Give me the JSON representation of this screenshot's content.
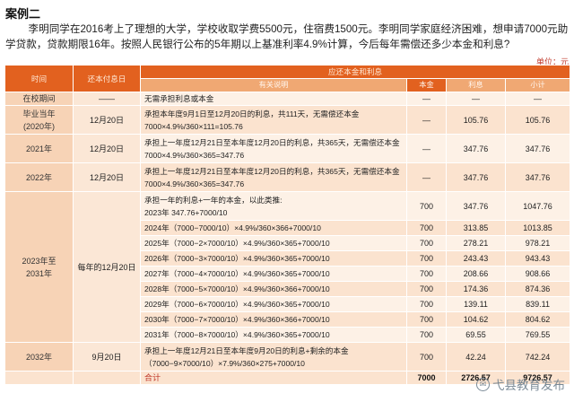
{
  "case_title": "案例二",
  "intro": "李明同学在2016考上了理想的大学，学校收取学费5500元，住宿费1500元。李明同学家庭经济困难，想申请7000元助学贷款，贷款期限16年。按照人民银行公布的5年期以上基准利率4.9%计算，今后每年需偿还多少本金和利息?",
  "unit": "单位：元",
  "headers": {
    "time": "时间",
    "pay_date": "还本付息日",
    "group": "应还本金和利息",
    "desc": "有关说明",
    "principal": "本金",
    "interest": "利息",
    "subtotal": "小计"
  },
  "rows": {
    "r0": {
      "time": "在校期间",
      "date": "——",
      "desc": "无需承担利息或本金",
      "principal": "—",
      "interest": "—",
      "subtotal": "—"
    },
    "r1": {
      "time": "毕业当年\n(2020年)",
      "date": "12月20日",
      "desc": "承担本年度9月1日至12月20日的利息，共111天，无需偿还本金\n7000×4.9%/360×111=105.76",
      "principal": "—",
      "interest": "105.76",
      "subtotal": "105.76"
    },
    "r2": {
      "time": "2021年",
      "date": "12月20日",
      "desc": "承担上一年度12月21日至本年度12月20日的利息，共365天，无需偿还本金\n7000×4.9%/360×365=347.76",
      "principal": "—",
      "interest": "347.76",
      "subtotal": "347.76"
    },
    "r3": {
      "time": "2022年",
      "date": "12月20日",
      "desc": "承担上一年度12月21日至本年度12月20日的利息，共365天，无需偿还本金\n7000×4.9%/360×365=347.76",
      "principal": "—",
      "interest": "347.76",
      "subtotal": "347.76"
    },
    "r4": {
      "desc": "承担一年的利息+一年的本金，以此类推:\n2023年 347.76+7000/10",
      "principal": "700",
      "interest": "347.76",
      "subtotal": "1047.76"
    },
    "r5": {
      "desc": "2024年（7000−7000/10）×4.9%/360×366+7000/10",
      "principal": "700",
      "interest": "313.85",
      "subtotal": "1013.85"
    },
    "r6": {
      "desc": "2025年（7000−2×7000/10）×4.9%/360×365+7000/10",
      "principal": "700",
      "interest": "278.21",
      "subtotal": "978.21"
    },
    "r7": {
      "desc": "2026年（7000−3×7000/10）×4.9%/360×365+7000/10",
      "principal": "700",
      "interest": "243.43",
      "subtotal": "943.43"
    },
    "r8": {
      "desc": "2027年（7000−4×7000/10）×4.9%/360×365+7000/10",
      "principal": "700",
      "interest": "208.66",
      "subtotal": "908.66"
    },
    "r9": {
      "desc": "2028年（7000−5×7000/10）×4.9%/360×366+7000/10",
      "principal": "700",
      "interest": "174.36",
      "subtotal": "874.36"
    },
    "r10": {
      "desc": "2029年（7000−6×7000/10）×4.9%/360×365+7000/10",
      "principal": "700",
      "interest": "139.11",
      "subtotal": "839.11"
    },
    "r11": {
      "desc": "2030年（7000−7×7000/10）×4.9%/360×366+7000/10",
      "principal": "700",
      "interest": "104.62",
      "subtotal": "804.62"
    },
    "r12": {
      "desc": "2031年（7000−8×7000/10）×4.9%/360×365+7000/10",
      "principal": "700",
      "interest": "69.55",
      "subtotal": "769.55"
    },
    "r13": {
      "time": "2032年",
      "date": "9月20日",
      "desc": "承担上一年度12月21日至本年度9月20日的利息+剩余的本金\n（7000−9×7000/10）×7.9%/360×275+7000/10",
      "principal": "700",
      "interest": "42.24",
      "subtotal": "742.24"
    }
  },
  "group_2023": {
    "time": "2023年至\n2031年",
    "date": "每年的12月20日"
  },
  "total": {
    "label": "合计",
    "principal": "7000",
    "interest": "2726.57",
    "subtotal": "9726.57"
  },
  "watermark": "弋县教育发布"
}
